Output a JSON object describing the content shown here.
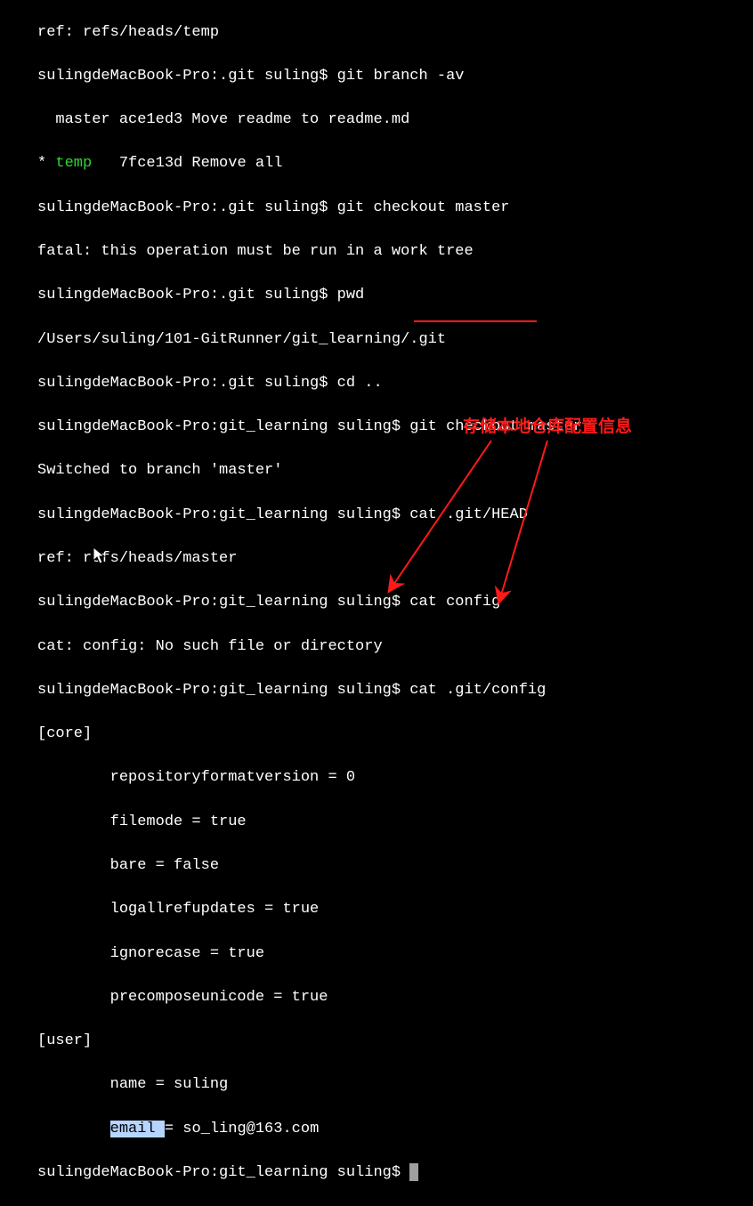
{
  "lines": {
    "l0": "ref: refs/heads/temp",
    "l1a": "sulingdeMacBook-Pro:.git suling$ ",
    "l1b": "git branch -av",
    "l2": "  master ace1ed3 Move readme to readme.md",
    "l3a": "* ",
    "l3b": "temp",
    "l3c": "   7fce13d Remove all",
    "l4a": "sulingdeMacBook-Pro:.git suling$ ",
    "l4b": "git checkout master",
    "l5": "fatal: this operation must be run in a work tree",
    "l6a": "sulingdeMacBook-Pro:.git suling$ ",
    "l6b": "pwd",
    "l7": "/Users/suling/101-GitRunner/git_learning/.git",
    "l8a": "sulingdeMacBook-Pro:.git suling$ ",
    "l8b": "cd ..",
    "l9a": "sulingdeMacBook-Pro:git_learning suling$ ",
    "l9b": "git checkout master",
    "l10": "Switched to branch 'master'",
    "l11a": "sulingdeMacBook-Pro:git_learning suling$ ",
    "l11b": "cat .git/HEAD",
    "l12": "ref: refs/heads/master",
    "l13a": "sulingdeMacBook-Pro:git_learning suling$ ",
    "l13b": "cat config",
    "l14": "cat: config: No such file or directory",
    "l15a": "sulingdeMacBook-Pro:git_learning suling$ ",
    "l15b": "cat .git/config",
    "l16": "[core]",
    "l17": "        repositoryformatversion = 0",
    "l18": "        filemode = true",
    "l19": "        bare = false",
    "l20": "        logallrefupdates = true",
    "l21": "        ignorecase = true",
    "l22": "        precomposeunicode = true",
    "l23": "[user]",
    "l24": "        name = suling",
    "l25a": "        ",
    "l25b": "email ",
    "l25c": "= so_ling@163.com",
    "l26": "sulingdeMacBook-Pro:git_learning suling$ "
  },
  "annotation": "存储本地仓库配置信息"
}
